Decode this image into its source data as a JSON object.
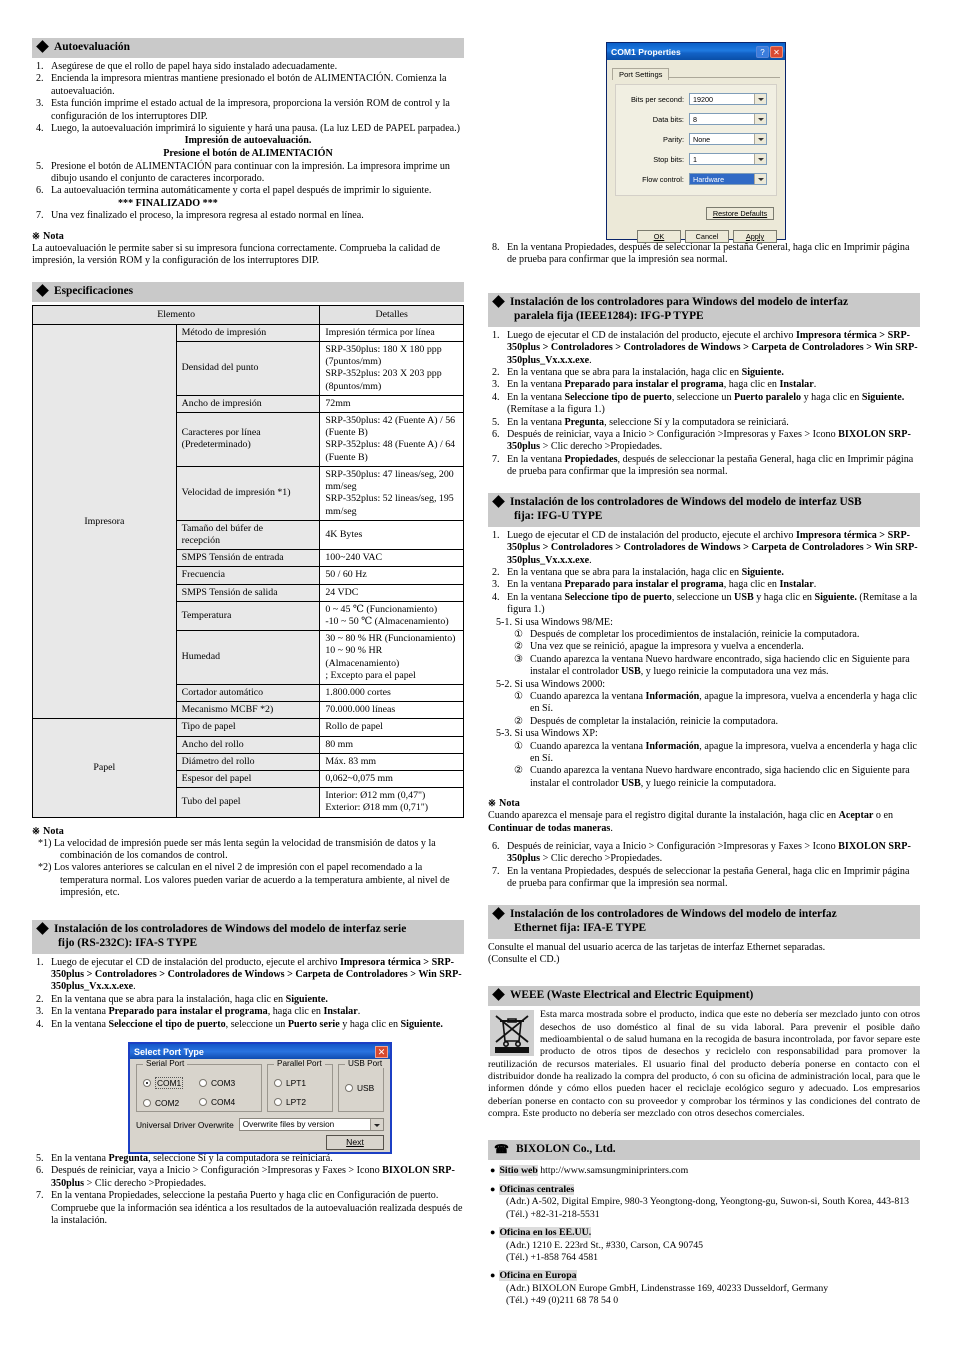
{
  "left": {
    "self_test": {
      "heading": "Autoevaluación",
      "steps": [
        {
          "num": "1.",
          "text": "Asegúrese de que el rollo de papel haya sido instalado adecuadamente."
        },
        {
          "num": "2.",
          "text": "Encienda la impresora mientras mantiene presionado el botón de ALIMENTACIÓN. Comienza la autoevaluación."
        },
        {
          "num": "3.",
          "text": "Esta función imprime el estado actual de la impresora, proporciona la versión ROM de control y la configuración de los interruptores DIP."
        },
        {
          "num": "4.",
          "text": "Luego, la autoevaluación imprimirá lo siguiente y hará una pausa. (La luz LED de PAPEL parpadea.)"
        }
      ],
      "printout_line1": "Impresión de autoevaluación.",
      "printout_line2": "Presione el botón de ALIMENTACIÓN",
      "steps2": [
        {
          "num": "5.",
          "text": "Presione el botón de ALIMENTACIÓN para continuar con la impresión. La impresora imprime un dibujo usando el conjunto de caracteres incorporado."
        },
        {
          "num": "6.",
          "text": "La autoevaluación termina automáticamente y corta el papel después de imprimir lo siguiente."
        }
      ],
      "finished_line": "*** FINALIZADO ***",
      "steps3": [
        {
          "num": "7.",
          "text": "Una vez finalizado el proceso, la impresora regresa al estado normal en línea."
        }
      ],
      "note_label": "Nota",
      "note_text": "La autoevaluación le permite saber si su impresora funciona correctamente. Comprueba la calidad de impresión, la versión ROM y la configuración de los interruptores DIP."
    },
    "specs": {
      "heading": "Especificaciones",
      "columns": [
        "Elemento",
        "Detalles"
      ],
      "groups": [
        {
          "name": "Impresora",
          "rows": [
            {
              "item": "Método de impresión",
              "detail": "Impresión térmica por línea"
            },
            {
              "item": "Densidad del punto",
              "detail": "SRP-350plus: 180 X 180 ppp (7puntos/mm)\nSRP-352plus: 203 X 203 ppp (8puntos/mm)"
            },
            {
              "item": "Ancho de impresión",
              "detail": "72mm"
            },
            {
              "item": "Caracteres por línea\n(Predeterminado)",
              "detail": "SRP-350plus: 42 (Fuente A) / 56 (Fuente B)\nSRP-352plus: 48 (Fuente A) / 64 (Fuente B)"
            },
            {
              "item": "Velocidad de impresión *1)",
              "detail": "SRP-350plus: 47 lineas/seg, 200 mm/seg\nSRP-352plus: 52 lineas/seg, 195 mm/seg"
            },
            {
              "item": "Tamaño del búfer de\nrecepción",
              "detail": "4K Bytes"
            },
            {
              "item": "SMPS Tensión de entrada",
              "detail": "100~240 VAC"
            },
            {
              "item": "Frecuencia",
              "detail": "50 / 60 Hz"
            },
            {
              "item": "SMPS Tensión de salida",
              "detail": "24 VDC"
            },
            {
              "item": "Temperatura",
              "detail": "0 ~ 45 ℃ (Funcionamiento)\n-10 ~ 50 ℃ (Almacenamiento)"
            },
            {
              "item": "Humedad",
              "detail": "30 ~ 80 % HR (Funcionamiento)\n10 ~ 90 % HR (Almacenamiento)\n; Excepto para el papel"
            },
            {
              "item": "Cortador automático",
              "detail": "1.800.000 cortes"
            },
            {
              "item": "Mecanismo MCBF *2)",
              "detail": "70.000.000 líneas"
            }
          ]
        },
        {
          "name": "Papel",
          "rows": [
            {
              "item": "Tipo de papel",
              "detail": "Rollo de papel"
            },
            {
              "item": "Ancho del rollo",
              "detail": "80  mm"
            },
            {
              "item": "Diámetro del rollo",
              "detail": "Máx. 83 mm"
            },
            {
              "item": "Espesor del papel",
              "detail": "0,062~0,075 mm"
            },
            {
              "item": "Tubo del papel",
              "detail": "Interior: Ø12 mm (0,47\")\nExterior: Ø18 mm (0,71\")"
            }
          ]
        }
      ],
      "note_label": "Nota",
      "notes": [
        "*1) La velocidad de impresión puede ser más lenta según la velocidad de transmisión de datos y la combinación de los comandos de control.",
        "*2) Los valores anteriores se calculan en el nivel 2 de impresión con el papel recomendado a la temperatura normal. Los valores pueden variar de acuerdo a la temperatura ambiente, al nivel de impresión, etc."
      ]
    },
    "serial_install": {
      "heading_line1": "Instalación de los controladores de Windows del modelo de interfaz serie",
      "heading_line2": "fijo (RS-232C): IFA-S TYPE",
      "steps": [
        {
          "num": "1.",
          "pre": "Luego de ejecutar el CD de instalación del producto, ejecute el archivo ",
          "bold": "Impresora térmica > SRP-350plus > Controladores > Controladores de Windows > Carpeta de Controladores > Win SRP-350plus_Vx.x.x.exe",
          "post": "."
        },
        {
          "num": "2.",
          "pre": "En la ventana que se abra para la instalación, haga clic en ",
          "bold": "Siguiente.",
          "post": ""
        },
        {
          "num": "3.",
          "pre": "En la ventana ",
          "bold": "Preparado para instalar el programa",
          "mid": ", haga clic en ",
          "bold2": "Instalar",
          "post": "."
        },
        {
          "num": "4.",
          "pre": "En la ventana ",
          "bold": "Seleccione el tipo de puerto",
          "mid": ", seleccione un ",
          "bold2": "Puerto serie",
          "mid2": " y haga clic en ",
          "bold3": "Siguiente.",
          "post": ""
        }
      ],
      "steps_after": [
        {
          "num": "5.",
          "pre": "En la ventana ",
          "bold": "Pregunta",
          "post": ", seleccione Sí y la computadora se reiniciará."
        },
        {
          "num": "6.",
          "pre": "Después de reiniciar, vaya a Inicio > Configuración >Impresoras y Faxes > Icono ",
          "bold": "BIXOLON SRP-350plus",
          "post": " > Clic derecho >Propiedades."
        },
        {
          "num": "7.",
          "pre": "En la ventana Propiedades, seleccione la pestaña Puerto y haga clic en Configuración de puerto. Compruebe que la información sea idéntica a los resultados de la autoevaluación realizada después de la instalación.",
          "bold": "",
          "post": ""
        }
      ]
    },
    "port_dialog": {
      "title": "Select Port Type",
      "close_icon": "close-icon",
      "serial_legend": "Serial Port",
      "parallel_legend": "Parallel Port",
      "usb_legend": "USB Port",
      "serial_options": [
        "COM1",
        "COM2",
        "COM3",
        "COM4"
      ],
      "serial_selected": "COM1",
      "parallel_options": [
        "LPT1",
        "LPT2"
      ],
      "usb_options": [
        "USB"
      ],
      "overwrite_label": "Universal Driver Overwrite",
      "overwrite_value": "Overwrite files by version",
      "next_button": "Next"
    }
  },
  "right": {
    "com_dialog": {
      "title": "COM1 Properties",
      "help_icon": "help-icon",
      "close_icon": "close-icon",
      "tab": "Port Settings",
      "fields": [
        {
          "label": "Bits per second:",
          "value": "19200",
          "selected": false
        },
        {
          "label": "Data bits:",
          "value": "8",
          "selected": false
        },
        {
          "label": "Parity:",
          "value": "None",
          "selected": false
        },
        {
          "label": "Stop bits:",
          "value": "1",
          "selected": false
        },
        {
          "label": "Flow control:",
          "value": "Hardware",
          "selected": true
        }
      ],
      "restore_button": "Restore Defaults",
      "ok_button": "OK",
      "cancel_button": "Cancel",
      "apply_button": "Apply"
    },
    "step8": {
      "num": "8.",
      "text": "En la ventana Propiedades, después de seleccionar la pestaña General, haga clic en Imprimir página de prueba para confirmar que la impresión sea normal."
    },
    "parallel_install": {
      "heading_line1": "Instalación de los controladores para Windows del modelo de interfaz",
      "heading_line2": "paralela fija (IEEE1284): IFG-P TYPE",
      "steps": [
        {
          "num": "1.",
          "pre": "Luego de ejecutar el CD de instalación del producto, ejecute el archivo ",
          "bold": "Impresora térmica > SRP-350plus > Controladores > Controladores de Windows > Carpeta de Controladores > Win SRP-350plus_Vx.x.x.exe",
          "post": "."
        },
        {
          "num": "2.",
          "pre": "En la ventana que se abra para la instalación, haga clic en ",
          "bold": "Siguiente.",
          "post": ""
        },
        {
          "num": "3.",
          "pre": "En la ventana ",
          "bold": "Preparado para instalar el programa",
          "mid": ", haga clic en ",
          "bold2": "Instalar",
          "post": "."
        },
        {
          "num": "4.",
          "pre": "En la ventana ",
          "bold": "Seleccione tipo de puerto",
          "mid": ", seleccione un ",
          "bold2": "Puerto paralelo",
          "mid2": " y haga clic en ",
          "bold3": "Siguiente.",
          "post": " (Remítase a la figura 1.)"
        },
        {
          "num": "5.",
          "pre": "En la ventana ",
          "bold": "Pregunta",
          "post": ", seleccione Sí y la computadora se reiniciará."
        },
        {
          "num": "6.",
          "pre": "Después de reiniciar, vaya a Inicio > Configuración >Impresoras y Faxes > Icono ",
          "bold": "BIXOLON SRP-350plus",
          "post": " > Clic derecho >Propiedades."
        },
        {
          "num": "7.",
          "pre": "En la ventana ",
          "bold": "Propiedades",
          "post": ", después de seleccionar la pestaña General, haga clic en Imprimir página de prueba para confirmar que la impresión sea normal."
        }
      ]
    },
    "usb_install": {
      "heading_line1": "Instalación de los controladores de Windows del modelo de interfaz USB",
      "heading_line2": "fija: IFG-U TYPE",
      "steps": [
        {
          "num": "1.",
          "pre": "Luego de ejecutar el CD de instalación del producto, ejecute el archivo ",
          "bold": "Impresora térmica > SRP-350plus > Controladores > Controladores de Windows > Carpeta de Controladores > Win SRP-350plus_Vx.x.x.exe",
          "post": "."
        },
        {
          "num": "2.",
          "pre": "En la ventana que se abra para la instalación, haga clic en ",
          "bold": "Siguiente.",
          "post": ""
        },
        {
          "num": "3.",
          "pre": "En la ventana ",
          "bold": "Preparado para instalar el programa",
          "mid": ", haga clic en ",
          "bold2": "Instalar",
          "post": "."
        },
        {
          "num": "4.",
          "pre": "En la ventana ",
          "bold": "Seleccione tipo de puerto",
          "mid": ", seleccione un ",
          "bold2": "USB",
          "mid2": " y haga clic en ",
          "bold3": "Siguiente.",
          "post": " (Remítase a la figura 1.)"
        }
      ],
      "win98": {
        "num": "5-1.",
        "title": "Si usa Windows 98/ME:",
        "subs": [
          {
            "cnum": "①",
            "text": "Después de completar los procedimientos de instalación, reinicie la computadora."
          },
          {
            "cnum": "②",
            "text": "Una vez que se reinició, apague la impresora y vuelva a encenderla."
          },
          {
            "cnum": "③",
            "pre": "Cuando aparezca la ventana Nuevo hardware encontrado, siga haciendo clic en Siguiente para instalar el controlador ",
            "bold": "USB",
            "post": ", y luego reinicie la computadora una vez más."
          }
        ]
      },
      "win2000": {
        "num": "5-2.",
        "title": "Si usa Windows 2000:",
        "subs": [
          {
            "cnum": "①",
            "pre": "Cuando aparezca la ventana ",
            "bold": "Información",
            "post": ", apague la impresora, vuelva a encenderla y haga clic en Sí."
          },
          {
            "cnum": "②",
            "pre": "Después de completar la instalación, reinicie la computadora.",
            "bold": "",
            "post": ""
          }
        ]
      },
      "winxp": {
        "num": "5-3.",
        "title": "Si usa Windows XP:",
        "subs": [
          {
            "cnum": "①",
            "pre": "Cuando aparezca la ventana ",
            "bold": "Información",
            "post": ", apague la impresora, vuelva a encenderla y haga clic en Sí."
          },
          {
            "cnum": "②",
            "pre": "Cuando aparezca la ventana Nuevo hardware encontrado, siga haciendo clic en Siguiente para instalar el controlador ",
            "bold": "USB",
            "post": ", y luego reinicie la computadora."
          }
        ]
      },
      "note_label": "Nota",
      "note_pre": "Cuando aparezca el mensaje para el registro digital durante la instalación, haga clic en ",
      "note_bold1": "Aceptar",
      "note_mid": " o en ",
      "note_bold2": "Continuar de todas maneras",
      "note_post": ".",
      "steps_after": [
        {
          "num": "6.",
          "pre": "Después de reiniciar, vaya a Inicio > Configuración >Impresoras y Faxes > Icono ",
          "bold": "BIXOLON SRP-350plus",
          "post": " > Clic derecho >Propiedades."
        },
        {
          "num": "7.",
          "pre": "En la ventana Propiedades, después de seleccionar la pestaña General, haga clic en Imprimir página de prueba para confirmar que la impresión sea normal.",
          "bold": "",
          "post": ""
        }
      ]
    },
    "ethernet_install": {
      "heading_line1": "Instalación de los controladores de Windows del modelo de interfaz",
      "heading_line2": "Ethernet fija: IFA-E TYPE",
      "text_line1": "Consulte el manual del usuario acerca de las tarjetas de interfaz Ethernet separadas.",
      "text_line2": "(Consulte el CD.)"
    },
    "weee": {
      "heading": "WEEE (Waste Electrical and Electric Equipment)",
      "icon": "crossed-out-wheelie-bin-icon",
      "body": "Esta marca mostrada sobre el producto, indica que este no debería ser mezclado junto con otros desechos de uso doméstico al final de su vida laboral. Para prevenir el posible daño medioambiental o de salud humana en la recogida de basura incontrolada, por favor separe este producto de otros tipos de desechos y reciclelo con responsabilidad para promover la reutilización de recursos materiales. El usuario final del producto debería ponerse en contacto con el distribuidor donde ha realizado la compra del producto, ó con su oficina de administración local, para que le informen dónde y cómo ellos pueden hacer el reciclaje ecológico seguro y adecuado. Los empresarios deberían ponerse en contacto con su proveedor y comprobar los términos y las condiciones del contrato de compra. Este producto no debería ser mezclado con otros desechos comerciales."
    },
    "company": {
      "heading": "BIXOLON Co., Ltd.",
      "phone_icon": "telephone-icon",
      "web_label": "Sitio web",
      "web_value": "http://www.samsungminiprinters.com",
      "offices": [
        {
          "label": "Oficinas centrales",
          "lines": [
            "(Adr.) A-502, Digital Empire, 980-3 Yeongtong-dong, Yeongtong-gu, Suwon-si, South Korea, 443-813",
            "(Tél.) +82-31-218-5531"
          ]
        },
        {
          "label": "Oficina en los EE.UU.",
          "lines": [
            "(Adr.) 1210 E. 223rd St., #330, Carson, CA 90745",
            "(Tél.) +1-858 764 4581"
          ]
        },
        {
          "label": "Oficina en Europa",
          "lines": [
            "(Adr.) BIXOLON Europe GmbH, Lindenstrasse 169, 40233 Dusseldorf, Germany",
            "(Tél.) +49 (0)211 68 78 54 0"
          ]
        }
      ]
    }
  }
}
